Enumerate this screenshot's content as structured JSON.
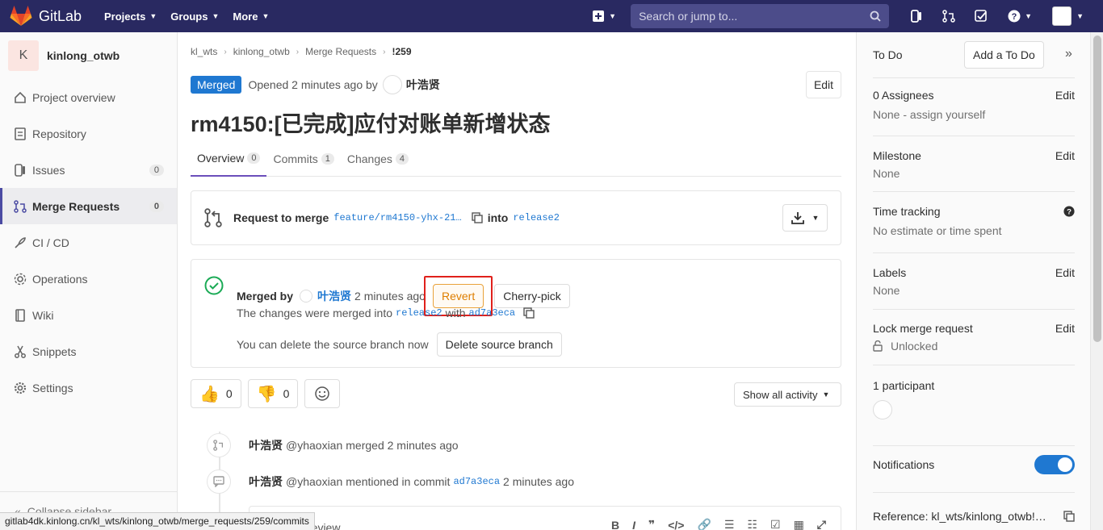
{
  "nav": {
    "logo_text": "GitLab",
    "projects": "Projects",
    "groups": "Groups",
    "more": "More",
    "search_placeholder": "Search or jump to..."
  },
  "sidebar": {
    "project_initial": "K",
    "project_name": "kinlong_otwb",
    "items": [
      {
        "label": "Project overview",
        "icon": "home-icon"
      },
      {
        "label": "Repository",
        "icon": "doc-icon"
      },
      {
        "label": "Issues",
        "icon": "issues-icon",
        "count": "0"
      },
      {
        "label": "Merge Requests",
        "icon": "merge-request-icon",
        "count": "0"
      },
      {
        "label": "CI / CD",
        "icon": "rocket-icon"
      },
      {
        "label": "Operations",
        "icon": "cloud-gear-icon"
      },
      {
        "label": "Wiki",
        "icon": "book-icon"
      },
      {
        "label": "Snippets",
        "icon": "scissors-icon"
      },
      {
        "label": "Settings",
        "icon": "gear-icon"
      }
    ],
    "collapse": "Collapse sidebar"
  },
  "status_url": "gitlab4dk.kinlong.cn/kl_wts/kinlong_otwb/merge_requests/259/commits",
  "breadcrumb": [
    "kl_wts",
    "kinlong_otwb",
    "Merge Requests",
    "!259"
  ],
  "mr": {
    "state": "Merged",
    "opened": "Opened 2 minutes ago by",
    "author": "叶浩贤",
    "edit": "Edit",
    "title": "rm4150:[已完成]应付对账单新增状态",
    "tabs": [
      {
        "label": "Overview",
        "count": "0"
      },
      {
        "label": "Commits",
        "count": "1"
      },
      {
        "label": "Changes",
        "count": "4"
      }
    ],
    "request_label": "Request to merge",
    "source_branch": "feature/rm4150-yhx-21…",
    "into": "into",
    "target_branch": "release2",
    "merged_by": "Merged by",
    "merged_user": "叶浩贤",
    "merged_time": "2 minutes ago",
    "revert": "Revert",
    "cherry_pick": "Cherry-pick",
    "merged_into_text": "The changes were merged into",
    "merged_into_branch": "release2",
    "with": "with",
    "commit_sha": "ad7a3eca",
    "delete_text": "You can delete the source branch now",
    "delete_btn": "Delete source branch",
    "thumbs_up": "0",
    "thumbs_down": "0",
    "activity_filter": "Show all activity",
    "notes": [
      {
        "author": "叶浩贤",
        "handle": "@yhaoxian",
        "text": "merged 2 minutes ago"
      },
      {
        "author": "叶浩贤",
        "handle": "@yhaoxian",
        "text": "mentioned in commit",
        "sha": "ad7a3eca",
        "time": "2 minutes ago"
      }
    ],
    "comment_tab": "review"
  },
  "right": {
    "todo": "To Do",
    "add_todo": "Add a To Do",
    "assignees": "0 Assignees",
    "assignees_value": "None - assign yourself",
    "milestone": "Milestone",
    "milestone_value": "None",
    "time_tracking": "Time tracking",
    "time_value": "No estimate or time spent",
    "labels": "Labels",
    "labels_value": "None",
    "lock": "Lock merge request",
    "lock_value": "Unlocked",
    "participants": "1 participant",
    "notifications": "Notifications",
    "reference": "Reference: kl_wts/kinlong_otwb!…",
    "edit": "Edit"
  },
  "colors": {
    "nav_bg": "#292961",
    "merged_blue": "#1f78d1",
    "revert_orange": "#de7e00",
    "highlight_red": "#e0201b",
    "success_green": "#1aaa55"
  }
}
